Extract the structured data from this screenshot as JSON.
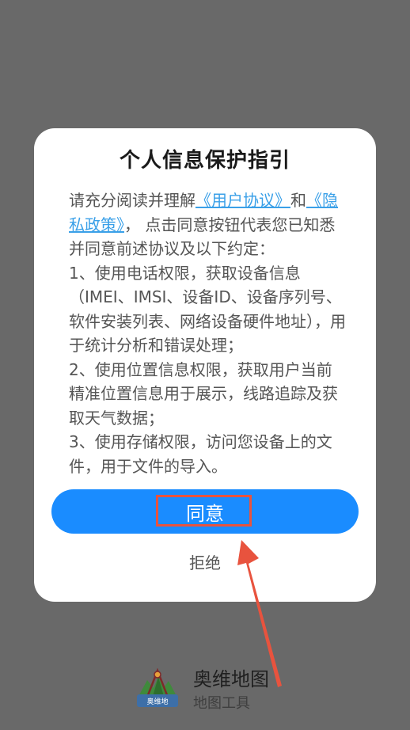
{
  "dialog": {
    "title": "个人信息保护指引",
    "intro": {
      "prefix": "请充分阅读并理解",
      "user_agreement_link": "《用户协议》",
      "connector": "和",
      "privacy_policy_link": "《隐私政策》",
      "suffix": "， 点击同意按钮代表您已知悉并同意前述协议及以下约定："
    },
    "items": [
      " 1、使用电话权限，获取设备信息（IMEI、IMSI、设备ID、设备序列号、软件安装列表、网络设备硬件地址），用于统计分析和错误处理；",
      " 2、使用位置信息权限，获取用户当前精准位置信息用于展示，线路追踪及获取天气数据；",
      " 3、使用存储权限，访问您设备上的文件，用于文件的导入。"
    ],
    "agree_label": "同意",
    "reject_label": "拒绝"
  },
  "app": {
    "logo_text": "奥维地",
    "name": "奥维地图",
    "subtitle": "地图工具"
  },
  "colors": {
    "overlay": "#696969",
    "primary": "#1a8cff",
    "link": "#3aa0e8",
    "annotation": "#e8533e"
  }
}
